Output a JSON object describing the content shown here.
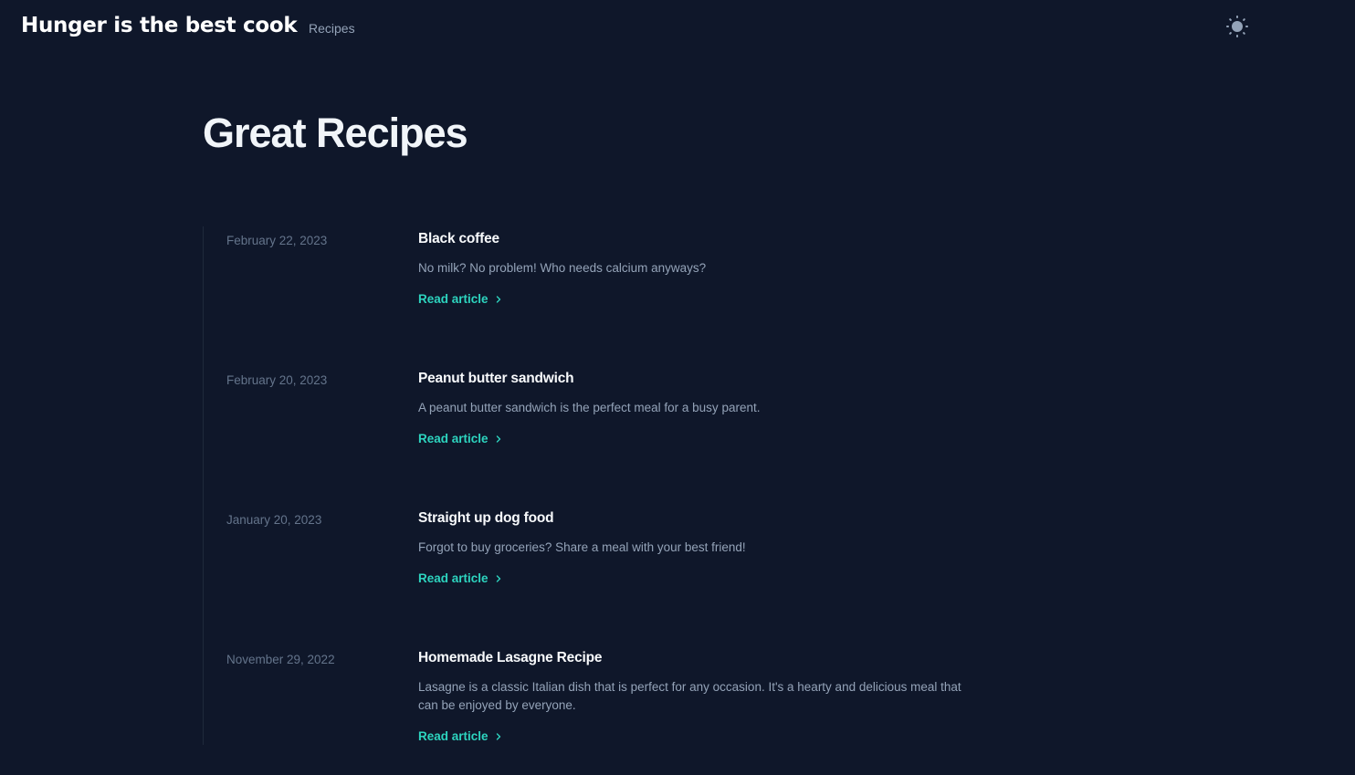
{
  "header": {
    "site_title": "Hunger is the best cook",
    "nav": [
      {
        "label": "Recipes"
      }
    ],
    "theme_toggle_icon": "sun-icon"
  },
  "main": {
    "title": "Great Recipes",
    "articles": [
      {
        "date": "February 22, 2023",
        "title": "Black coffee",
        "description": "No milk? No problem! Who needs calcium anyways?",
        "link_label": "Read article"
      },
      {
        "date": "February 20, 2023",
        "title": "Peanut butter sandwich",
        "description": "A peanut butter sandwich is the perfect meal for a busy parent.",
        "link_label": "Read article"
      },
      {
        "date": "January 20, 2023",
        "title": "Straight up dog food",
        "description": "Forgot to buy groceries? Share a meal with your best friend!",
        "link_label": "Read article"
      },
      {
        "date": "November 29, 2022",
        "title": "Homemade Lasagne Recipe",
        "description": "Lasagne is a classic Italian dish that is perfect for any occasion. It's a hearty and delicious meal that can be enjoyed by everyone.",
        "link_label": "Read article"
      }
    ]
  },
  "colors": {
    "background": "#0f172a",
    "accent": "#2dd4bf",
    "muted_text": "#94a3b8",
    "date_text": "#64748b"
  }
}
